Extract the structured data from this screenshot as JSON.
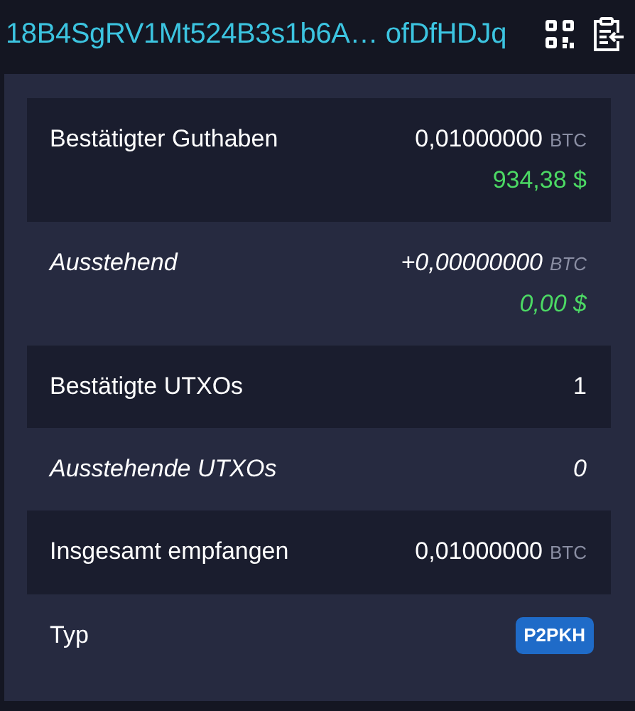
{
  "header": {
    "address": "18B4SgRV1Mt524B3s1b6A… ofDfHDJq"
  },
  "rows": [
    {
      "kind": "amount",
      "label": "Bestätigter Guthaben",
      "pending": false,
      "value": "0,01000000",
      "unit": "BTC",
      "fiat": "934,38 $"
    },
    {
      "kind": "amount",
      "label": "Ausstehend",
      "pending": true,
      "value": "+0,00000000",
      "unit": "BTC",
      "fiat": "0,00 $"
    },
    {
      "kind": "count",
      "label": "Bestätigte UTXOs",
      "pending": false,
      "value": "1"
    },
    {
      "kind": "count",
      "label": "Ausstehende UTXOs",
      "pending": true,
      "value": "0"
    },
    {
      "kind": "amount",
      "label": "Insgesamt empfangen",
      "pending": false,
      "value": "0,01000000",
      "unit": "BTC"
    },
    {
      "kind": "badge",
      "label": "Typ",
      "pending": false,
      "value": "P2PKH"
    }
  ]
}
